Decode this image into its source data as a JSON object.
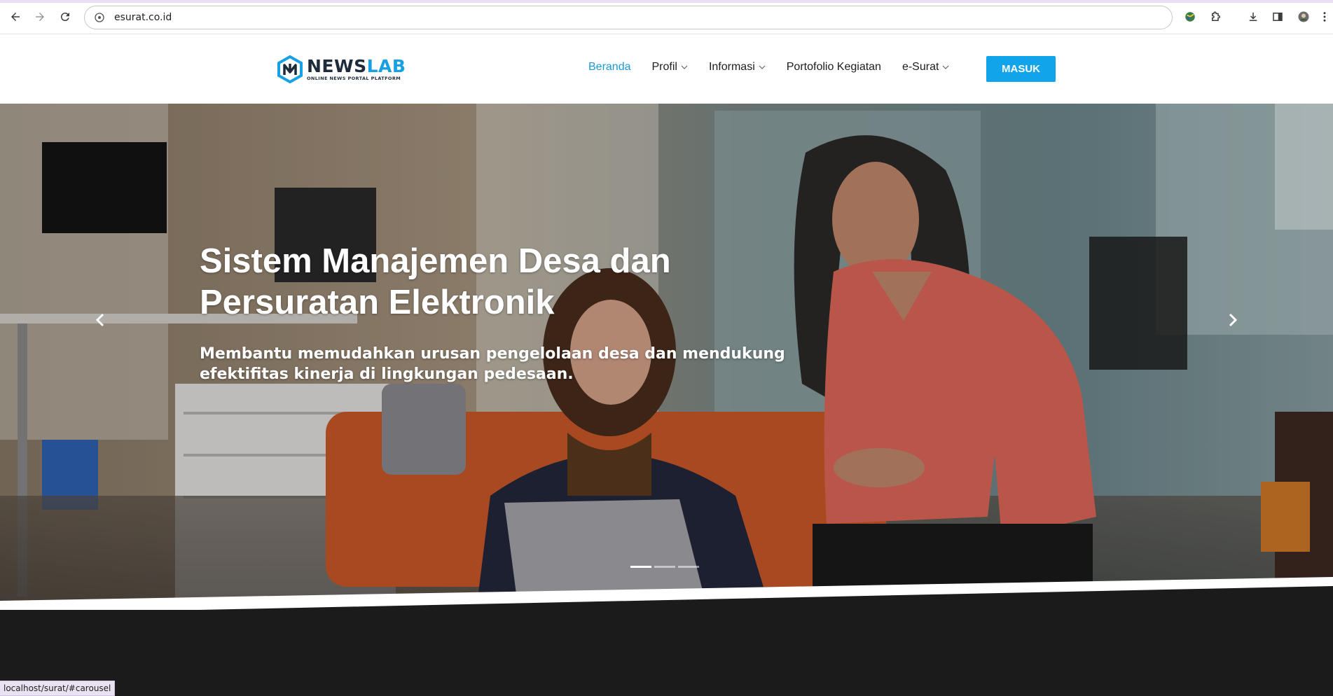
{
  "browser": {
    "url": "esurat.co.id",
    "status_url": "localhost/surat/#carousel"
  },
  "site": {
    "logo_name_part1": "NEWS",
    "logo_name_part2": "LAB",
    "logo_tagline": "ONLINE NEWS PORTAL PLATFORM",
    "nav": [
      {
        "label": "Beranda",
        "active": true,
        "dropdown": false
      },
      {
        "label": "Profil",
        "active": false,
        "dropdown": true
      },
      {
        "label": "Informasi",
        "active": false,
        "dropdown": true
      },
      {
        "label": "Portofolio Kegiatan",
        "active": false,
        "dropdown": false
      },
      {
        "label": "e-Surat",
        "active": false,
        "dropdown": true
      }
    ],
    "login_label": "MASUK",
    "accent_color": "#11a4ea"
  },
  "hero": {
    "title": "Sistem Manajemen Desa dan Persuratan Elektronik",
    "subtitle": "Membantu memudahkan urusan pengelolaan desa dan mendukung efektifitas kinerja di lingkungan pedesaan.",
    "slides_count": 3,
    "active_slide": 1
  }
}
